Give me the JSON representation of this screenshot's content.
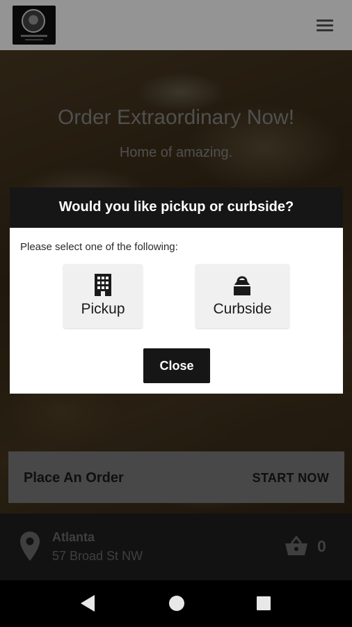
{
  "header": {
    "logo_icon": "restaurant-logo",
    "menu_icon": "hamburger-menu-icon"
  },
  "hero": {
    "title": "Order Extraordinary Now!",
    "subtitle": "Home of amazing."
  },
  "order_bar": {
    "label": "Place An Order",
    "action": "START NOW"
  },
  "location": {
    "icon": "location-pin-icon",
    "city": "Atlanta",
    "address": "57 Broad St NW"
  },
  "cart": {
    "icon": "shopping-basket-icon",
    "count": "0"
  },
  "dialog": {
    "title": "Would you like pickup or curbside?",
    "prompt": "Please select one of the following:",
    "options": [
      {
        "label": "Pickup",
        "icon": "building-icon"
      },
      {
        "label": "Curbside",
        "icon": "shopping-bag-icon"
      }
    ],
    "close_label": "Close"
  },
  "nav": {
    "back_icon": "back-triangle-icon",
    "home_icon": "home-circle-icon",
    "recents_icon": "recents-square-icon"
  },
  "colors": {
    "dialog_header": "#161616",
    "order_bar": "#7c7c7c",
    "location_bar": "#1f1f1f"
  }
}
